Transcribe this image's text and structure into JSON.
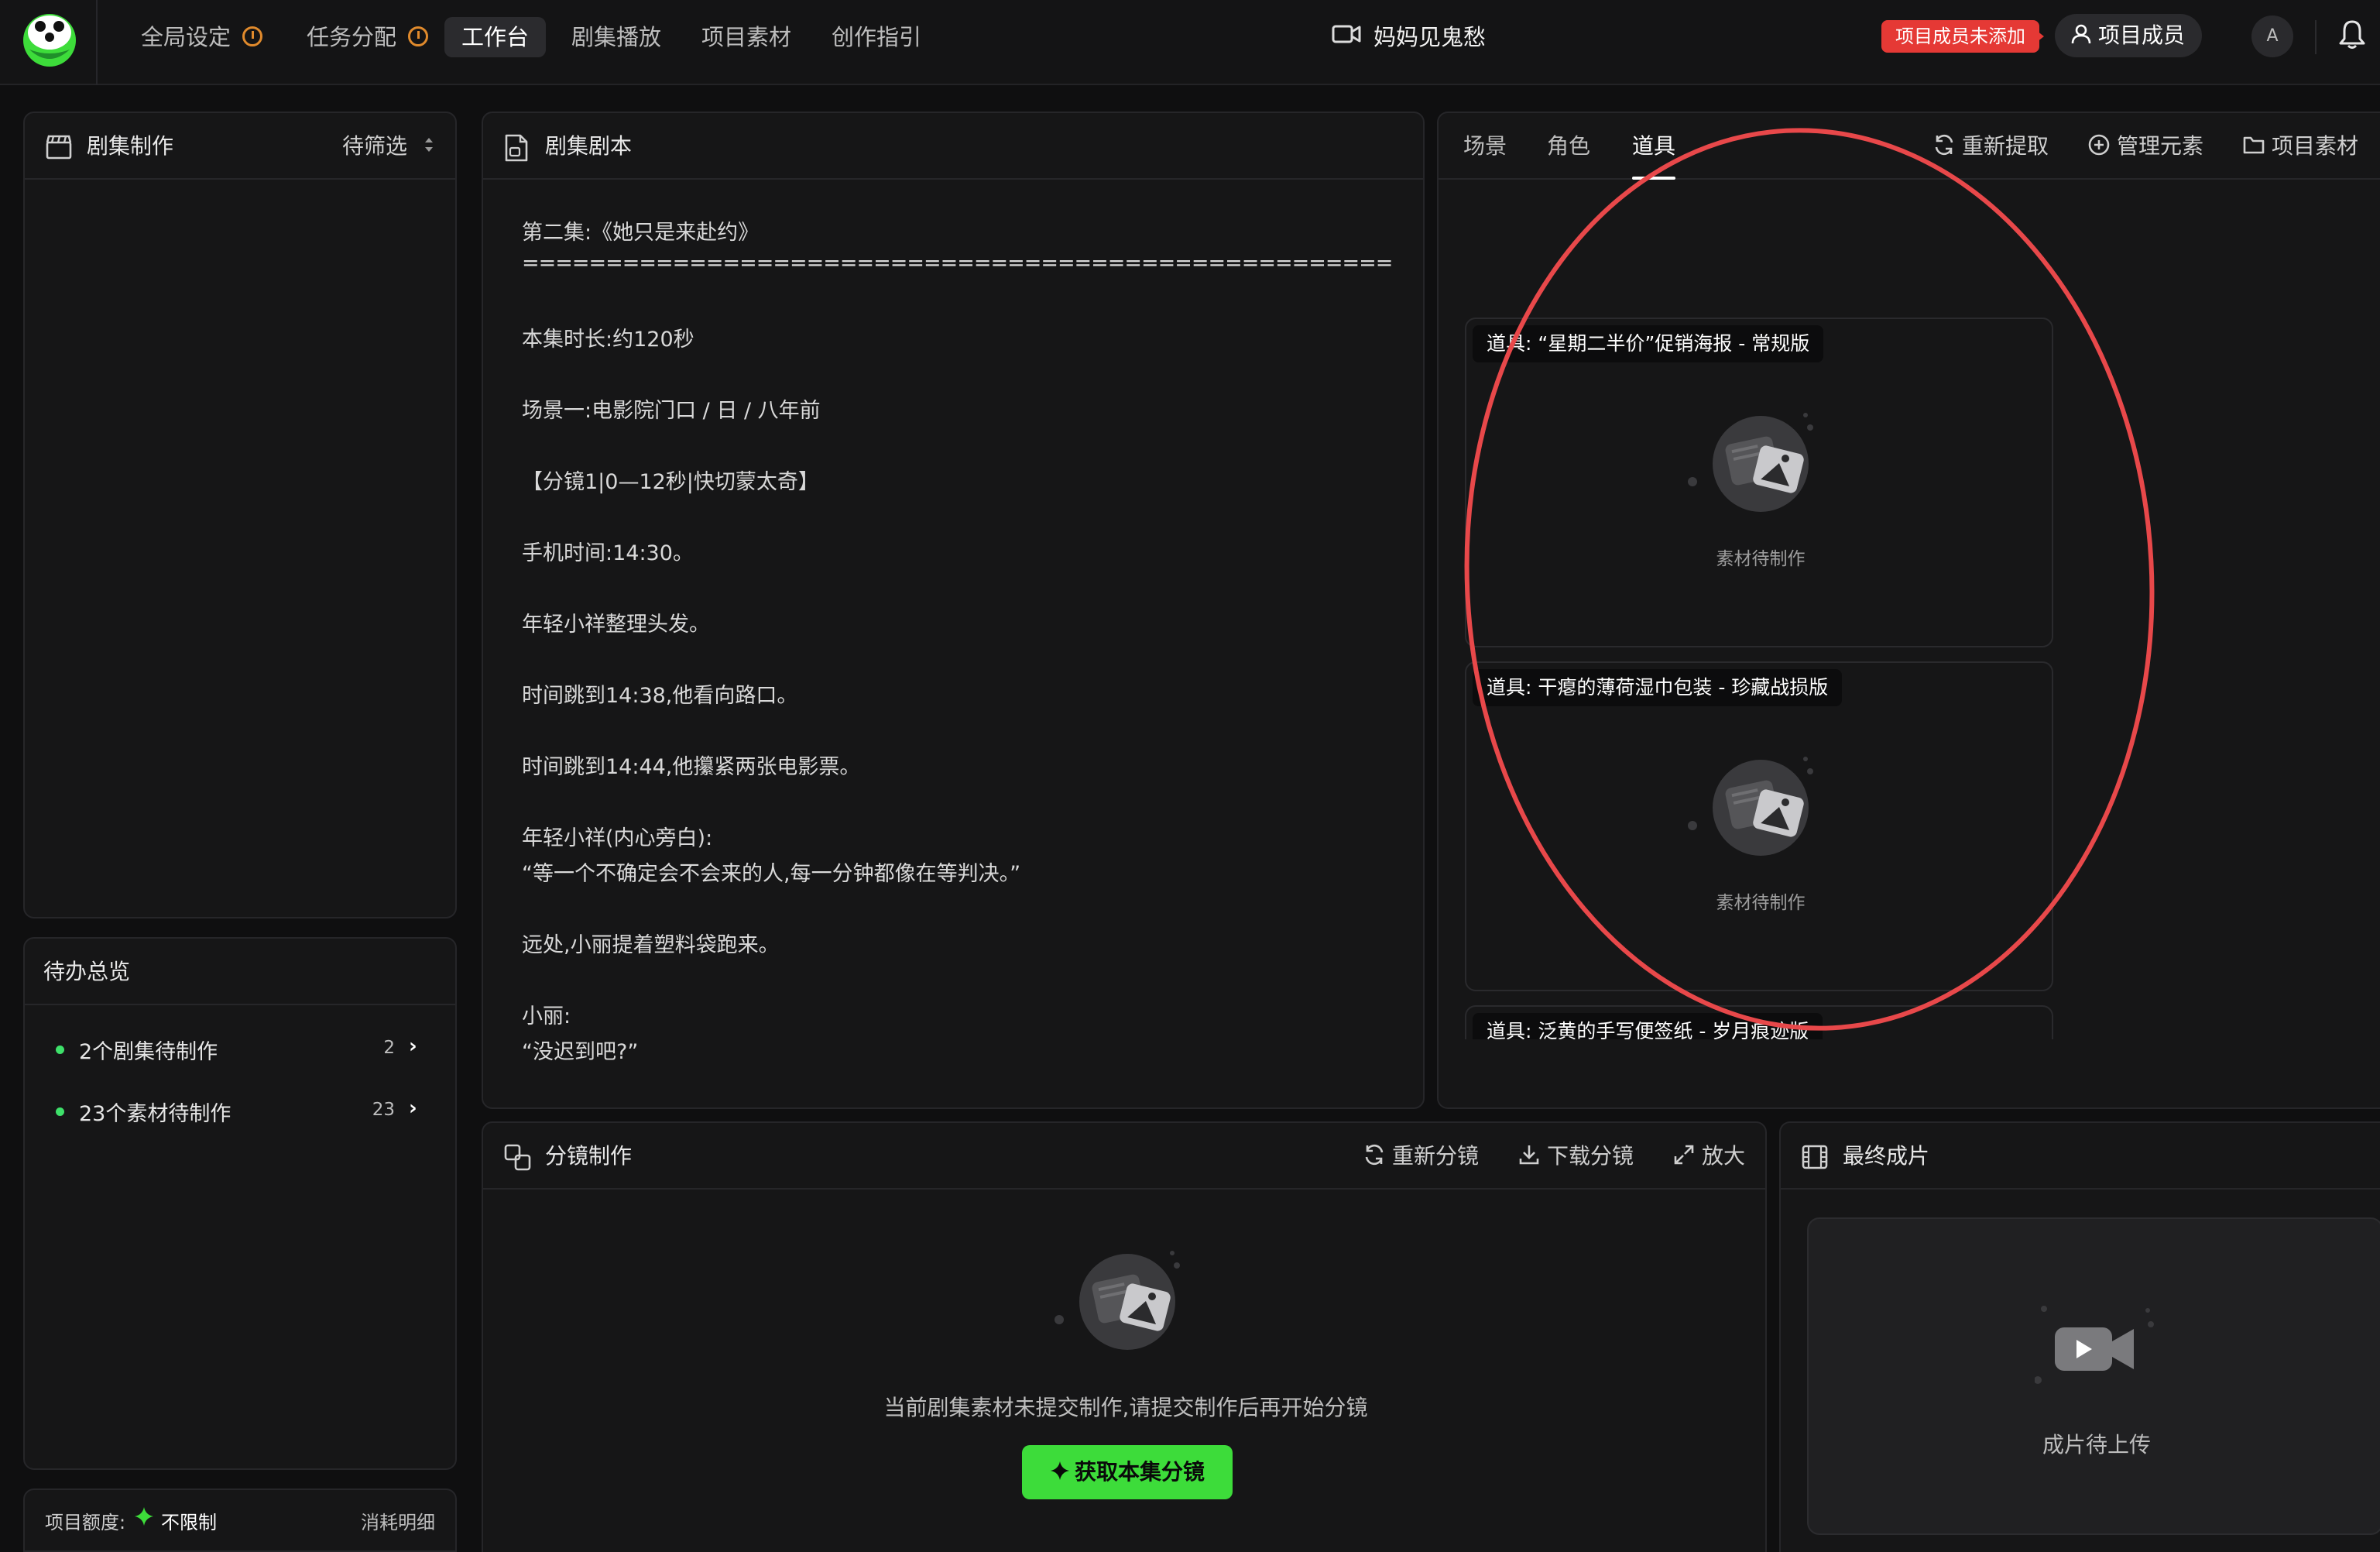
{
  "header": {
    "nav": [
      {
        "label": "全局设定"
      },
      {
        "label": "任务分配"
      },
      {
        "label": "工作台"
      },
      {
        "label": "剧集播放"
      },
      {
        "label": "项目素材"
      },
      {
        "label": "创作指引"
      }
    ],
    "project_title": "妈妈见鬼愁",
    "member_warning": "项目成员未添加",
    "member_button": "项目成员",
    "avatar": "A",
    "accent_green": "#3ddc3a",
    "warning_red": "#e53935"
  },
  "episodes_panel": {
    "title": "剧集制作",
    "filter": "待筛选"
  },
  "todo_panel": {
    "title": "待办总览",
    "items": [
      {
        "label": "2个剧集待制作",
        "count": "2"
      },
      {
        "label": "23个素材待制作",
        "count": "23"
      }
    ]
  },
  "quota": {
    "label": "项目额度:",
    "value": "不限制",
    "detail": "消耗明细"
  },
  "script_panel": {
    "title": "剧集剧本",
    "lines": [
      "第二集:《她只是来赴约》",
      "====================================================",
      "本集时长:约120秒",
      "场景一:电影院门口 / 日 / 八年前",
      "【分镜1|0—12秒|快切蒙太奇】",
      "手机时间:14:30。",
      "年轻小祥整理头发。",
      "时间跳到14:38,他看向路口。",
      "时间跳到14:44,他攥紧两张电影票。",
      "年轻小祥(内心旁白):",
      "“等一个不确定会不会来的人,每一分钟都像在等判决。”",
      "远处,小丽提着塑料袋跑来。",
      "小丽:",
      "“没迟到吧?”"
    ]
  },
  "elements_panel": {
    "tabs": [
      {
        "label": "场景"
      },
      {
        "label": "角色"
      },
      {
        "label": "道具"
      }
    ],
    "active_tab": "道具",
    "actions": {
      "re_extract": "重新提取",
      "manage": "管理元素",
      "assets": "项目素材"
    },
    "props": [
      {
        "label": "道具: “星期二半价”促销海报 - 常规版",
        "status": "素材待制作"
      },
      {
        "label": "道具: 干瘪的薄荷湿巾包装 - 珍藏战损版",
        "status": "素材待制作"
      },
      {
        "label": "道具: 泛黄的手写便签纸 - 岁月痕迹版",
        "status": ""
      }
    ]
  },
  "storyboard_panel": {
    "title": "分镜制作",
    "actions": {
      "redo": "重新分镜",
      "download": "下载分镜",
      "zoom": "放大"
    },
    "empty_text": "当前剧集素材未提交制作,请提交制作后再开始分镜",
    "button": "获取本集分镜"
  },
  "final_panel": {
    "title": "最终成片",
    "status": "成片待上传"
  }
}
